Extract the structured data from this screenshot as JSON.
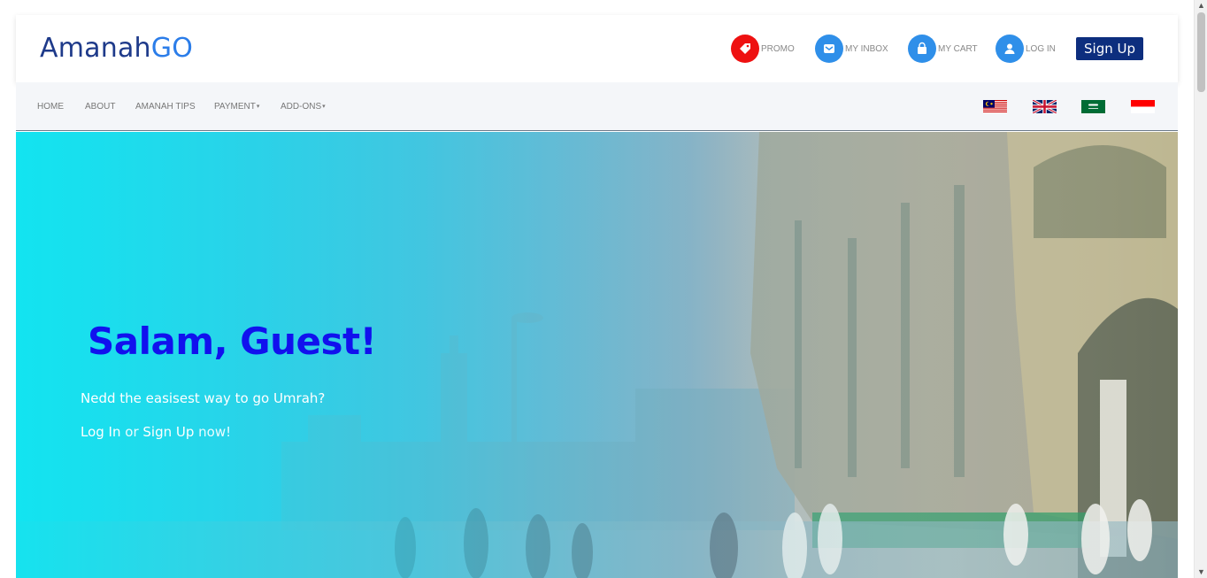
{
  "header": {
    "logo_main": "Amanah",
    "logo_accent": "GO",
    "links": {
      "promo": "PROMO",
      "inbox": "MY INBOX",
      "cart": "MY CART",
      "login": "LOG IN"
    },
    "signup_label": "Sign Up"
  },
  "nav": {
    "home": "HOME",
    "about": "ABOUT",
    "tips": "AMANAH TIPS",
    "payment": "PAYMENT",
    "addons": "ADD-ONS",
    "dropdown_caret": "▾",
    "flags": [
      "malaysia-flag",
      "uk-flag",
      "saudi-flag",
      "indonesia-flag"
    ]
  },
  "hero": {
    "title": "Salam, Guest!",
    "subtitle": "Nedd the easisest way to go Umrah?",
    "login_link": "Log In",
    "or_text": " or ",
    "signup_link": "Sign Up",
    "now_text": " now!"
  },
  "colors": {
    "brand_navy": "#0d2e7e",
    "brand_blue": "#2b7de9",
    "promo_red": "#ee1111",
    "icon_blue": "#2f8fe9",
    "hero_title": "#1111ee"
  }
}
